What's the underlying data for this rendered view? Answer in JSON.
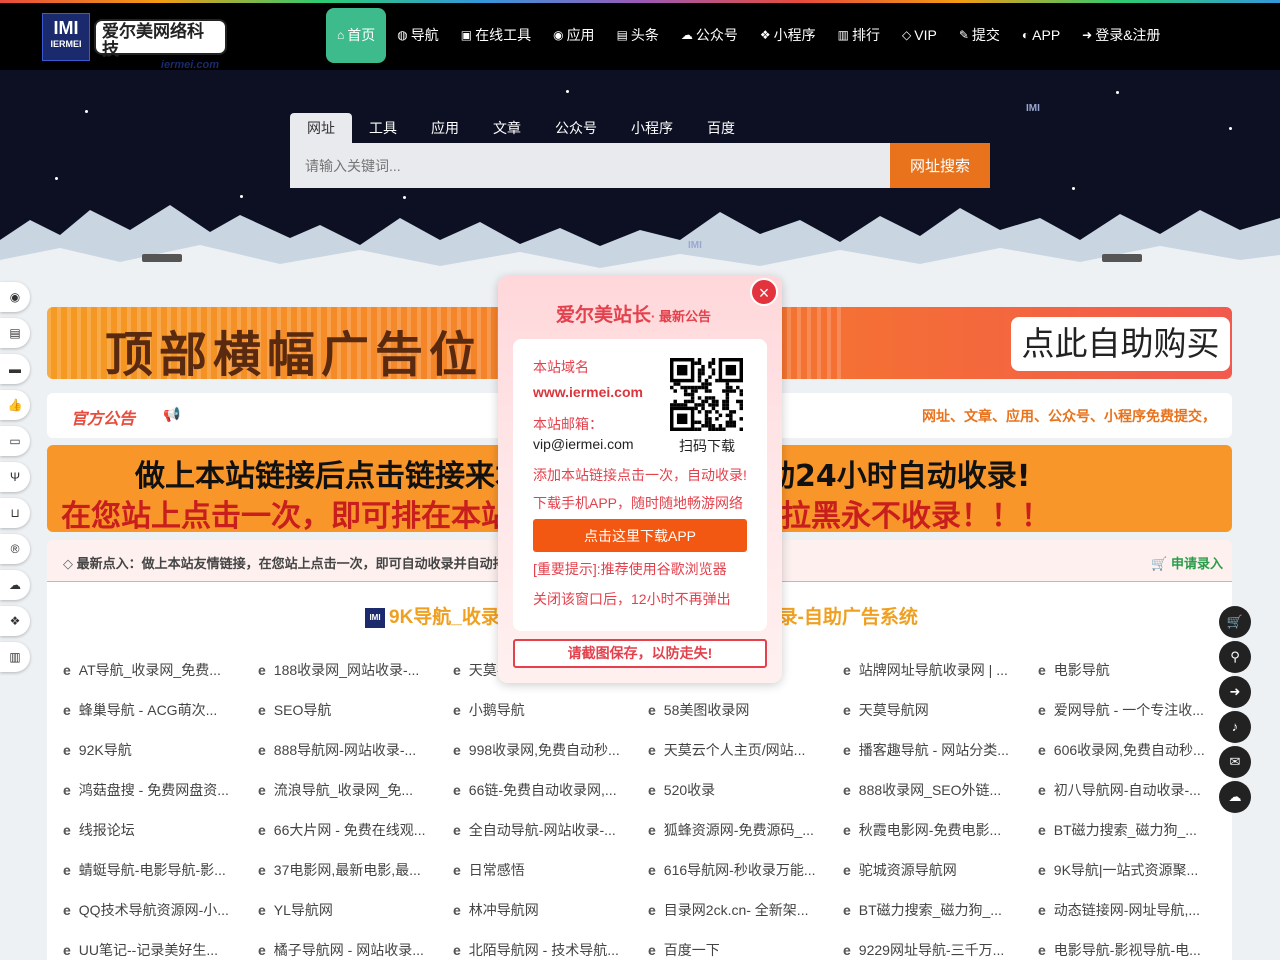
{
  "header": {
    "logo_mark": "IMI",
    "logo_cn": "爱尔美网络科技",
    "logo_en": "iermei.com",
    "nav": [
      {
        "label": "首页",
        "icon": "home-icon",
        "glyph": "⌂"
      },
      {
        "label": "导航",
        "icon": "globe-icon",
        "glyph": "◍"
      },
      {
        "label": "在线工具",
        "icon": "toolbox-icon",
        "glyph": "▣"
      },
      {
        "label": "应用",
        "icon": "github-icon",
        "glyph": "◉"
      },
      {
        "label": "头条",
        "icon": "newspaper-icon",
        "glyph": "▤"
      },
      {
        "label": "公众号",
        "icon": "wechat-icon",
        "glyph": "☁"
      },
      {
        "label": "小程序",
        "icon": "cubes-icon",
        "glyph": "❖"
      },
      {
        "label": "排行",
        "icon": "bar-chart-icon",
        "glyph": "▥"
      },
      {
        "label": "VIP",
        "icon": "diamond-icon",
        "glyph": "◇"
      },
      {
        "label": "提交",
        "icon": "edit-icon",
        "glyph": "✎"
      },
      {
        "label": "APP",
        "icon": "android-icon",
        "glyph": "◐"
      },
      {
        "label": "登录&注册",
        "icon": "sign-in-icon",
        "glyph": "➜"
      }
    ]
  },
  "search": {
    "tabs": [
      "网址",
      "工具",
      "应用",
      "文章",
      "公众号",
      "小程序",
      "百度"
    ],
    "placeholder": "请输入关键词...",
    "button": "网址搜索"
  },
  "banner_top": {
    "text": "顶部横幅广告位",
    "buy": "点此自助购买"
  },
  "announcement": {
    "title": "官方公告",
    "scroll": "网址、文章、应用、公众号、小程序免费提交，"
  },
  "banner_mid": {
    "line1": "做上本站链接后点击链接来本站自动收录，全自动24小时自动收录!",
    "line2": "在您站上点击一次，即可排在本站首页，反删除的永久拉黑永不收录！！！"
  },
  "panel": {
    "header": "最新点入：做上本站友情链接，在您站上点击一次，即可自动收录并自动排在本站首页！",
    "apply": "申请录入",
    "title": "9K导航_收录网_网址导航_网站收录_自动秒收录-自助广告系统",
    "title_mark": "IMI",
    "links": [
      [
        "AT导航_收录网_免费...",
        "188收录网_网站收录-...",
        "天莫导航网",
        "网站导航社|...",
        "站牌网址导航收录网 | ...",
        "电影导航"
      ],
      [
        "蜂巢导航 - ACG萌次...",
        "SEO导航",
        "小鹅导航",
        "58美图收录网",
        "天莫导航网",
        "爱网导航 - 一个专注收..."
      ],
      [
        "92K导航",
        "888导航网-网站收录-...",
        "998收录网,免费自动秒...",
        "天莫云个人主页/网站...",
        "播客趣导航 - 网站分类...",
        "606收录网,免费自动秒..."
      ],
      [
        "鸿菇盘搜 - 免费网盘资...",
        "流浪导航_收录网_免...",
        "66链-免费自动收录网,...",
        "520收录",
        "888收录网_SEO外链...",
        "初八导航网-自动收录-..."
      ],
      [
        "线报论坛",
        "66大片网 - 免费在线观...",
        "全自动导航-网站收录-...",
        "狐蜂资源网-免费源码_...",
        "秋霞电影网-免费电影...",
        "BT磁力搜索_磁力狗_..."
      ],
      [
        "蜻蜓导航-电影导航-影...",
        "37电影网,最新电影,最...",
        "日常感悟",
        "616导航网-秒收录万能...",
        "驼城资源导航网",
        "9K导航|一站式资源聚..."
      ],
      [
        "QQ技术导航资源网-小...",
        "YL导航网",
        "林冲导航网",
        "目录网2ck.cn- 全新架...",
        "BT磁力搜索_磁力狗_...",
        "动态链接网-网址导航,..."
      ],
      [
        "UU笔记--记录美好生...",
        "橘子导航网 - 网站收录...",
        "北陌导航网 - 技术导航...",
        "百度一下",
        "9229网址导航-三千万...",
        "电影导航-影视导航-电..."
      ]
    ]
  },
  "modal": {
    "title": "爱尔美站长",
    "subtitle": "· 最新公告",
    "domain_label": "本站域名",
    "domain": "www.iermei.com",
    "email_label": "本站邮箱：",
    "email": "vip@iermei.com",
    "qr_label": "扫码下载",
    "add_tip": "添加本站链接点击一次，自动收录!",
    "app_tip": "下载手机APP，随时随地畅游网络",
    "download_btn": "点击这里下载APP",
    "browser_tip": "[重要提示]:推荐使用谷歌浏览器",
    "close_tip": "关闭该窗口后，12小时不再弹出",
    "save_tip": "请截图保存，以防走失!"
  },
  "sidebar_icons": [
    "github-icon",
    "book-icon",
    "briefcase-icon",
    "thumbs-up-icon",
    "desktop-icon",
    "utensils-icon",
    "basket-icon",
    "registered-icon",
    "wechat-icon",
    "cubes-icon",
    "newspaper-icon"
  ],
  "rightbar_icons": [
    "cart-icon",
    "map-marker-icon",
    "sign-in-icon",
    "bell-icon",
    "envelope-icon",
    "wechat-icon"
  ],
  "colors": {
    "accent_green": "#3dbb8c",
    "accent_orange": "#e8731c",
    "accent_red": "#e4414c"
  }
}
